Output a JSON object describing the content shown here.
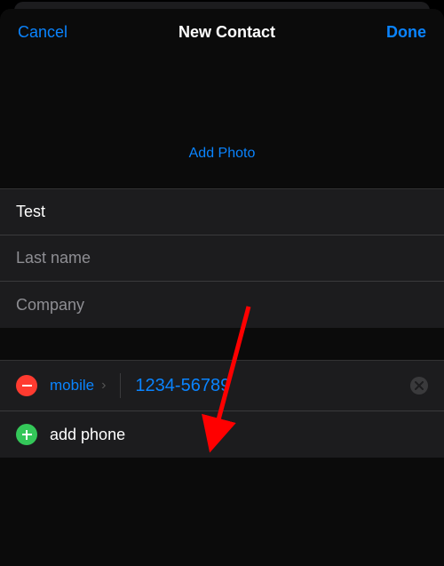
{
  "header": {
    "cancel": "Cancel",
    "title": "New Contact",
    "done": "Done"
  },
  "avatar": {
    "add_photo": "Add Photo"
  },
  "name_fields": {
    "first_name_value": "Test",
    "last_name_placeholder": "Last name",
    "company_placeholder": "Company"
  },
  "phone": {
    "label": "mobile",
    "value": "1234-56789",
    "add_phone": "add phone"
  },
  "colors": {
    "accent": "#0a84ff",
    "remove": "#ff3b30",
    "add": "#34c759"
  }
}
